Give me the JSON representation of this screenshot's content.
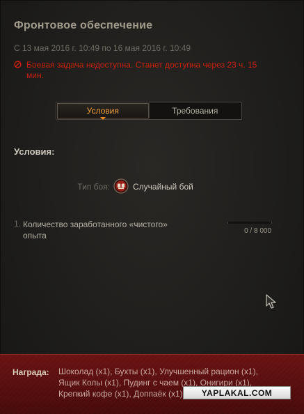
{
  "panel": {
    "title": "Фронтовое обеспечение",
    "date_range": "С 13 мая 2016 г. 10:49 по 16 мая 2016 г. 10:49",
    "warning": "Боевая задача недоступна. Станет доступна через 23 ч. 15 мин.",
    "warning_icon": "forbidden-icon"
  },
  "tabs": [
    {
      "label": "Условия",
      "active": true
    },
    {
      "label": "Требования",
      "active": false
    }
  ],
  "conditions": {
    "heading": "Условия:",
    "battle_type_label": "Тип боя:",
    "battle_type_icon": "random-battle-icon",
    "battle_type_value": "Случайный бой",
    "task_number": "1.",
    "task_text": "Количество заработанного «чистого» опыта",
    "progress_text": "0 / 8 000",
    "progress_fraction": 0
  },
  "reward": {
    "label": "Награда:",
    "items": "Шоколад (x1), Бухты (x1), Улучшенный рацион (x1), Ящик Колы (x1), Пудинг с чаем (x1), Онигири (x1), Крепкий кофе (x1), Доппаёк (x1)"
  },
  "watermark": "YAPLAKAL.COM",
  "colors": {
    "warning": "#c9210f",
    "active_tab": "#f2a13a",
    "reward_bg": "#6e1414"
  }
}
